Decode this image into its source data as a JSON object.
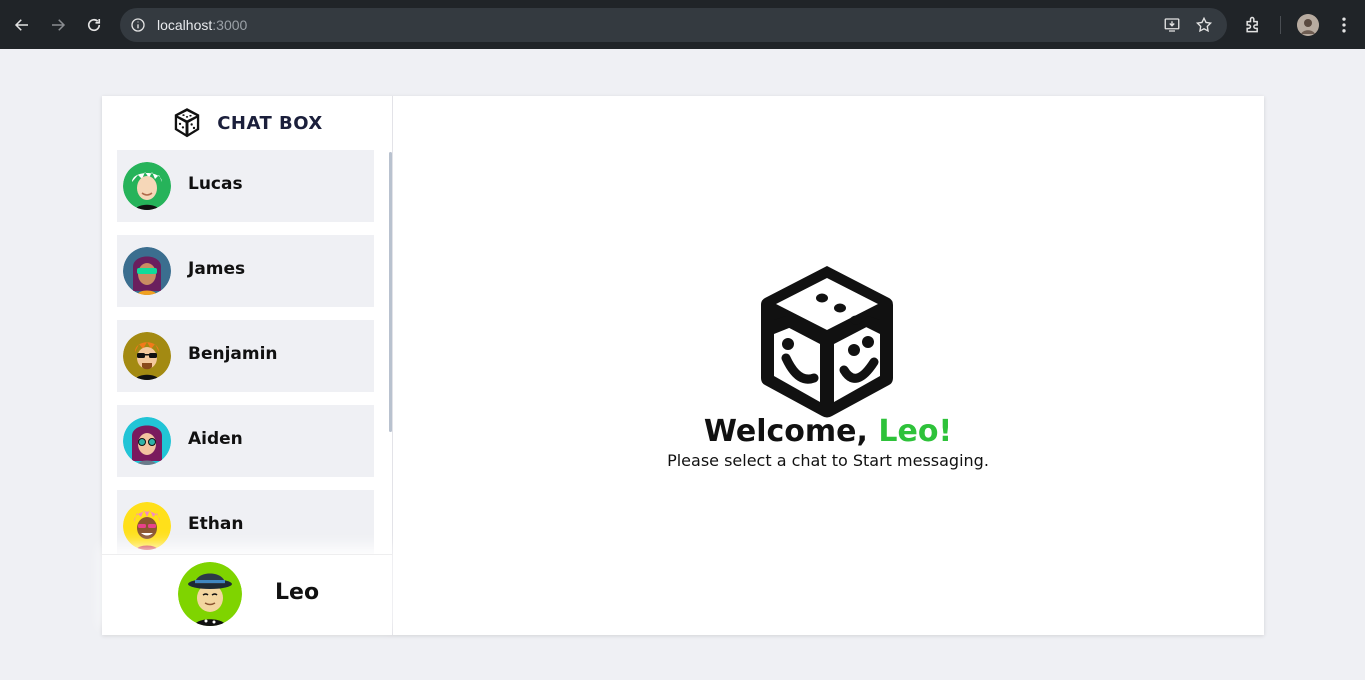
{
  "browser": {
    "url_host": "localhost",
    "url_port": ":3000"
  },
  "app": {
    "brand_title": "CHAT BOX",
    "contacts": [
      {
        "name": "Lucas",
        "avatar_bg": "#26b35a",
        "hair": "#ffffff",
        "skin": "#f6d7b8"
      },
      {
        "name": "James",
        "avatar_bg": "#3b6e8f",
        "hair": "#6a1f5e",
        "skin": "#c98d62"
      },
      {
        "name": "Benjamin",
        "avatar_bg": "#a38a12",
        "hair": "#f27a1a",
        "skin": "#f3c89c"
      },
      {
        "name": "Aiden",
        "avatar_bg": "#21c4d6",
        "hair": "#7a1a5e",
        "skin": "#f2c2a0"
      },
      {
        "name": "Ethan",
        "avatar_bg": "#ffe01a",
        "hair": "#f58ac0",
        "skin": "#8a5530"
      }
    ],
    "current_user": {
      "name": "Leo",
      "avatar_bg": "#7fd400"
    },
    "welcome": {
      "greeting": "Welcome,",
      "user": "Leo!",
      "subtitle": "Please select a chat to Start messaging."
    },
    "colors": {
      "accent": "#2ec23a",
      "panel_bg": "#eff0f4",
      "brand_text": "#1b1f3b"
    }
  }
}
